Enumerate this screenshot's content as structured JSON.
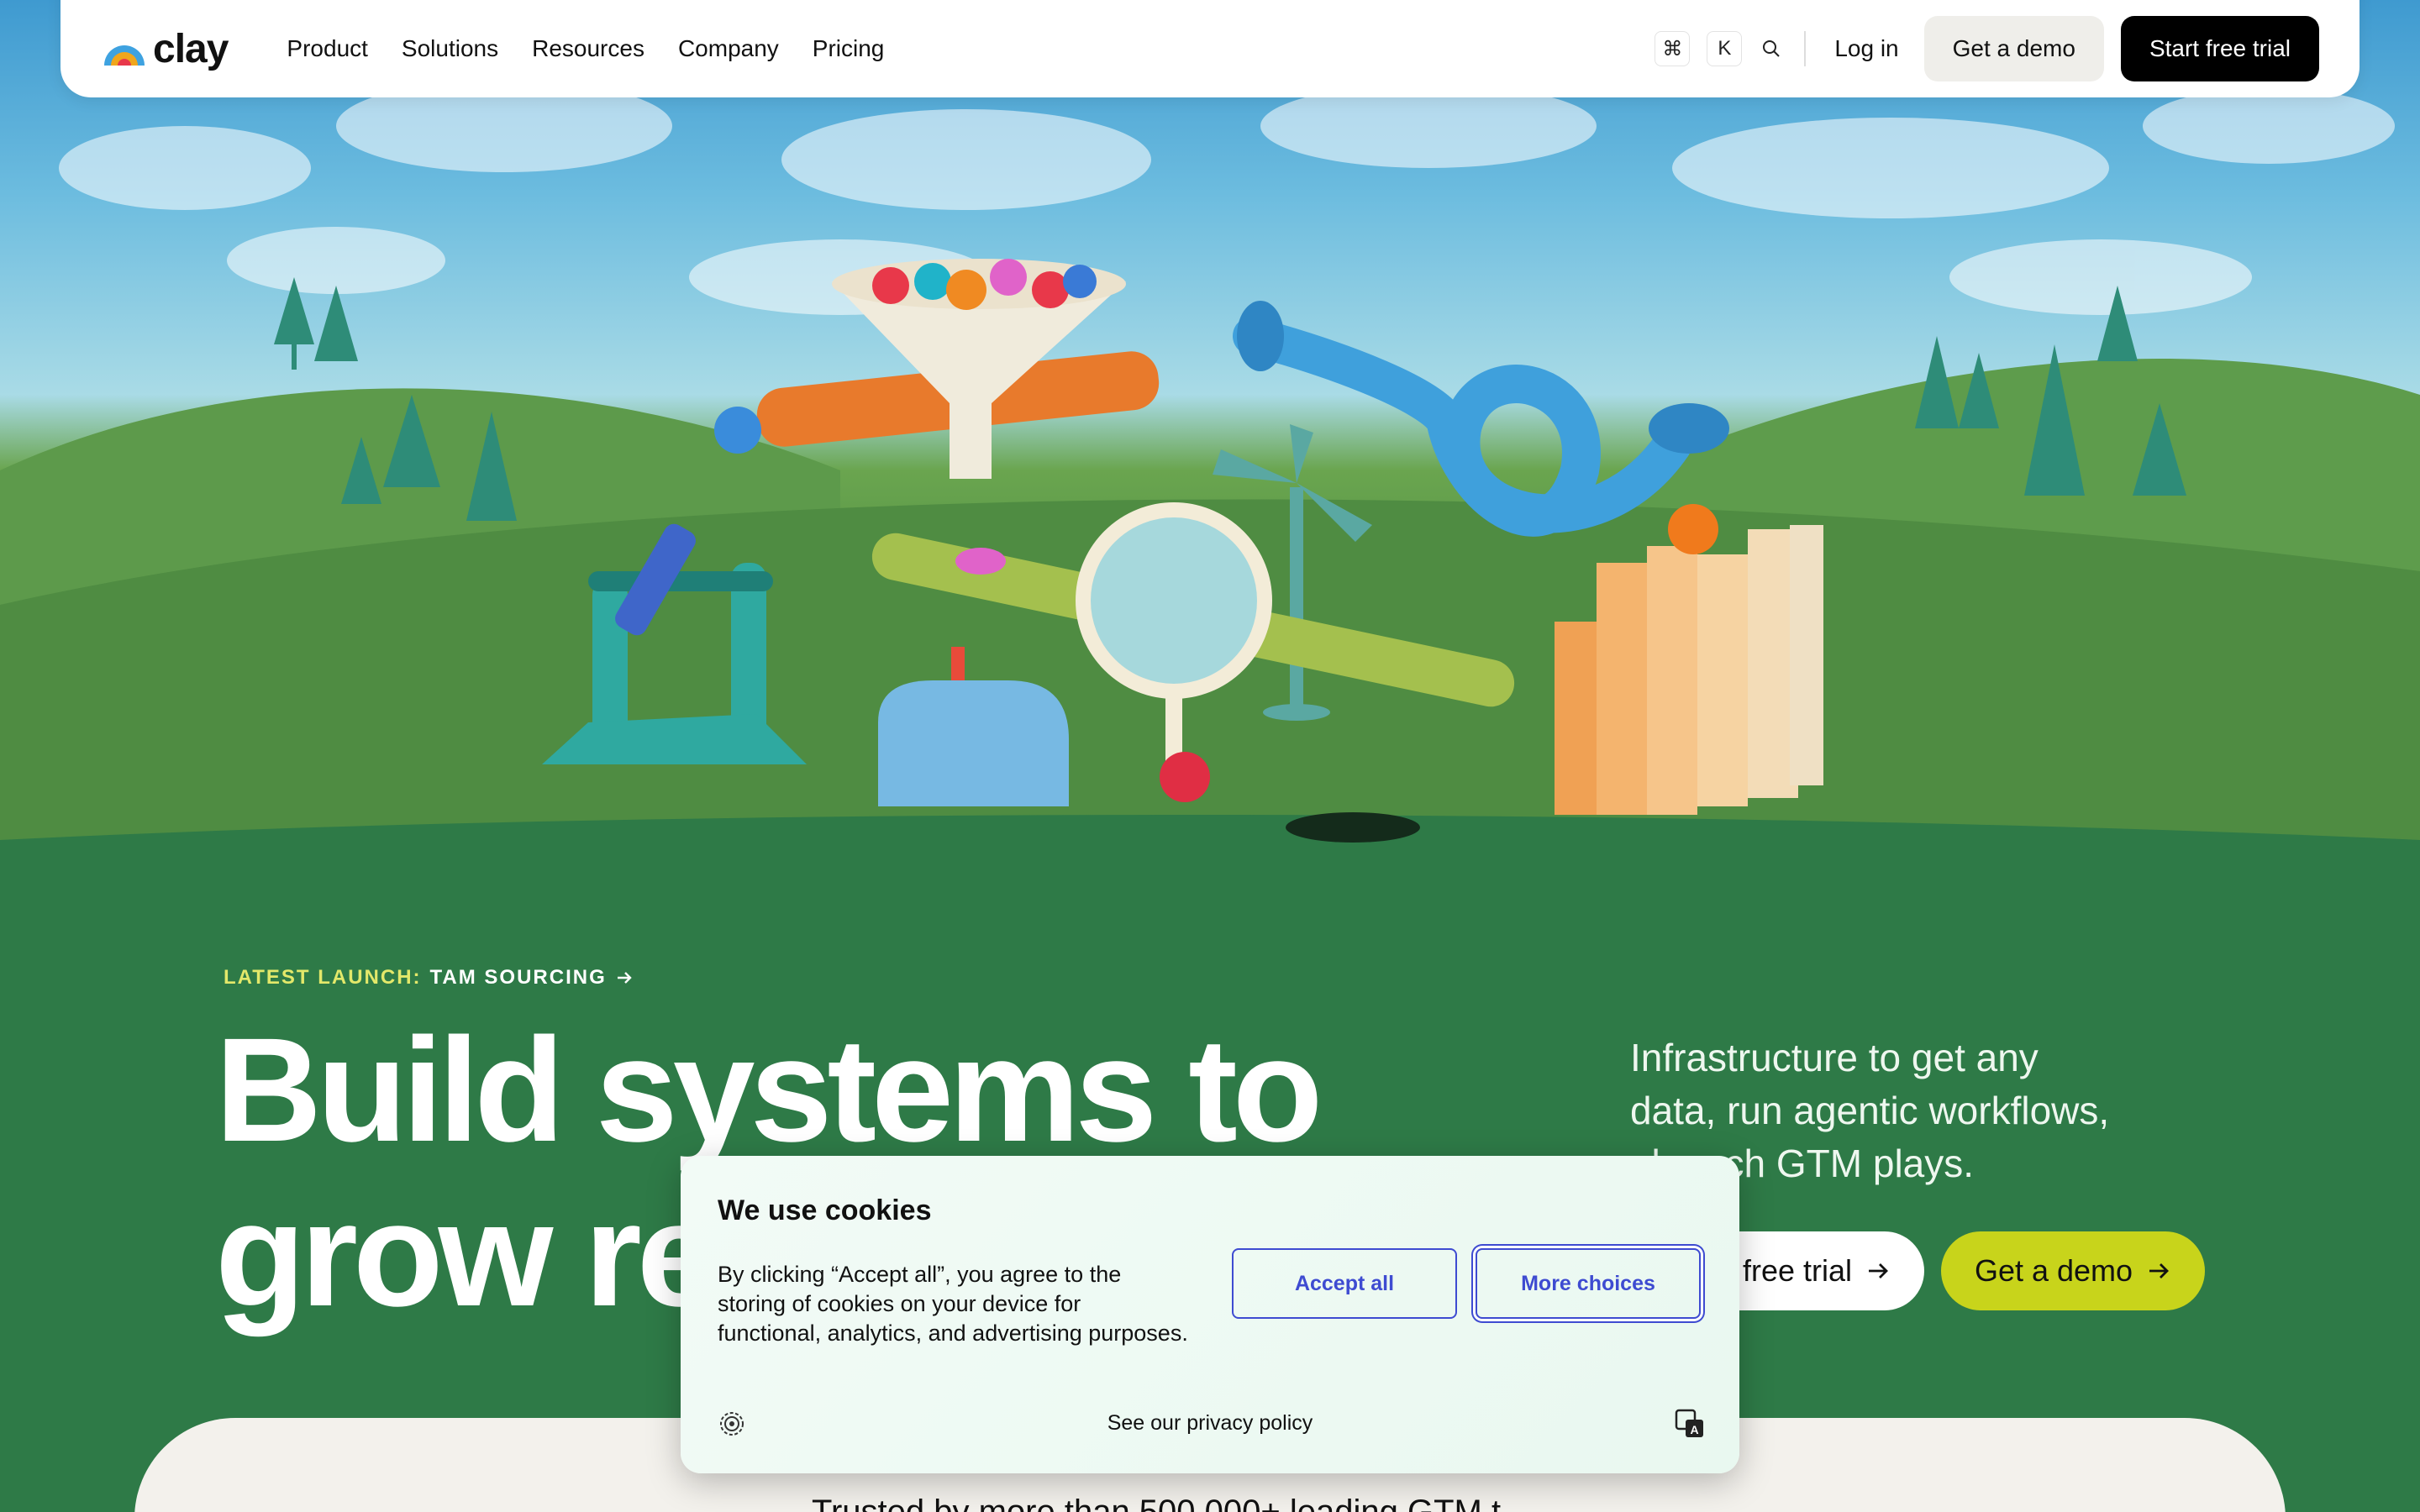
{
  "nav": {
    "logo_text": "clay",
    "links": [
      "Product",
      "Solutions",
      "Resources",
      "Company",
      "Pricing"
    ],
    "shortcut_cmd": "⌘",
    "shortcut_key": "K",
    "login": "Log in",
    "demo": "Get a demo",
    "trial": "Start free trial"
  },
  "hero": {
    "launch_label": "LATEST LAUNCH:",
    "launch_text": "TAM SOURCING",
    "headline_line1": "Build systems to",
    "headline_line2": "grow re",
    "subtext_line1": "Infrastructure to get any",
    "subtext_line2": "data, run agentic workflows,",
    "subtext_line3": "  launch GTM plays.",
    "trial_button": "free trial",
    "demo_button": "Get a demo"
  },
  "trusted": {
    "text": "Trusted by more than 500,000+ leading GTM t"
  },
  "cookie": {
    "title": "We use cookies",
    "body": "By clicking “Accept all”, you agree to the storing of cookies on your device for functional, analytics, and advertising purposes.",
    "accept": "Accept all",
    "more": "More choices",
    "privacy": "See our privacy policy"
  },
  "colors": {
    "accent_lime": "#c8d41b",
    "launch_yellow": "#e3e86a",
    "cookie_blue": "#3e4bd1",
    "hero_green": "#17704a"
  }
}
